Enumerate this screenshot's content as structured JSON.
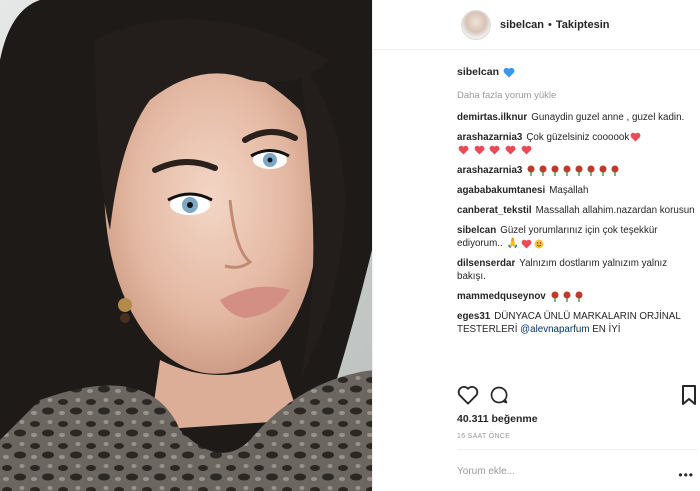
{
  "post": {
    "username": "sibelcan",
    "separator": "•",
    "follow_label": "Takiptesin",
    "caption_user": "sibelcan",
    "more_comments_label": "Daha fazla yorum yükle",
    "comments": [
      {
        "user": "demirtas.ilknur",
        "text": "Gunaydin guzel anne , guzel kadin."
      },
      {
        "user": "arashazarnia3",
        "text": "Çok güzelsiniz coooook"
      },
      {
        "user": "arashazarnia3",
        "text": ""
      },
      {
        "user": "agababakumtanesi",
        "text": "Maşallah"
      },
      {
        "user": "canberat_tekstil",
        "text": "Massallah allahim.nazardan korusun"
      },
      {
        "user": "sibelcan",
        "text": "Güzel yorumlarınız için çok teşekkür ediyorum.."
      },
      {
        "user": "dilsenserdar",
        "text": "Yalnızım dostlarım yalnızım yalnız bakışı."
      },
      {
        "user": "mammedquseynov",
        "text": ""
      },
      {
        "user": "eges31",
        "text": "DÜNYACA ÜNLÜ MARKALARIN ORJİNAL TESTERLERİ",
        "mention": "@alevnaparfum",
        "tail": "EN İYİ"
      }
    ],
    "likes": "40.311 beğenme",
    "time": "16 SAAT ÖNCE",
    "add_comment_placeholder": "Yorum ekle...",
    "more_options": "•••"
  },
  "colors": {
    "text": "#262626",
    "muted": "#999999",
    "mention": "#003569",
    "heart_red": "#ed4956",
    "heart_blue": "#3897f0",
    "rose": "#c0392b"
  },
  "icons": [
    "heart-blue-icon",
    "red-heart-icon",
    "rose-icon",
    "like-heart-icon",
    "comment-icon",
    "bookmark-icon",
    "more-options-icon"
  ]
}
